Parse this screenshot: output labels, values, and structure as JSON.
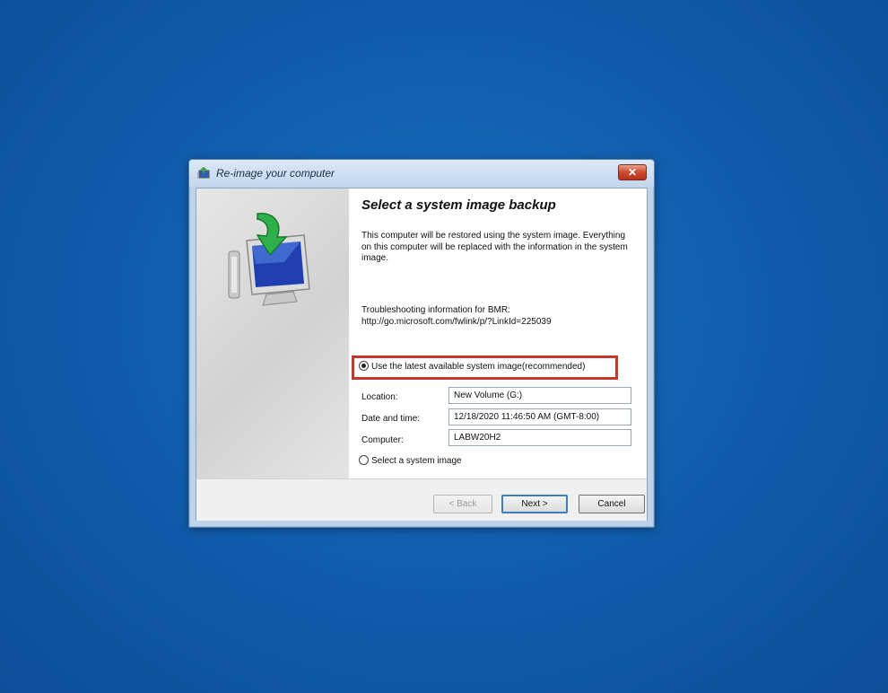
{
  "window": {
    "title": "Re-image your computer",
    "close_glyph": "✕"
  },
  "content": {
    "heading": "Select a system image backup",
    "description": "This computer will be restored using the system image. Everything on this computer will be replaced with the information in the system image.",
    "troubleshooting_label": "Troubleshooting information for BMR:",
    "troubleshooting_link": "http://go.microsoft.com/fwlink/p/?LinkId=225039",
    "option_latest": {
      "label": "Use the latest available system image(recommended)",
      "selected": true
    },
    "fields": {
      "location_label": "Location:",
      "location_value": "New Volume (G:)",
      "datetime_label": "Date and time:",
      "datetime_value": "12/18/2020 11:46:50 AM (GMT-8:00)",
      "computer_label": "Computer:",
      "computer_value": "LABW20H2"
    },
    "option_select": {
      "label": "Select a system image",
      "selected": false
    }
  },
  "buttons": {
    "back": "< Back",
    "next": "Next >",
    "cancel": "Cancel"
  },
  "colors": {
    "desktop": "#0f5aa8",
    "highlight_border": "#c0392b"
  },
  "icons": {
    "app": "restore-computer-icon",
    "hero": "monitor-restore-arrow-icon",
    "close": "close-icon"
  }
}
